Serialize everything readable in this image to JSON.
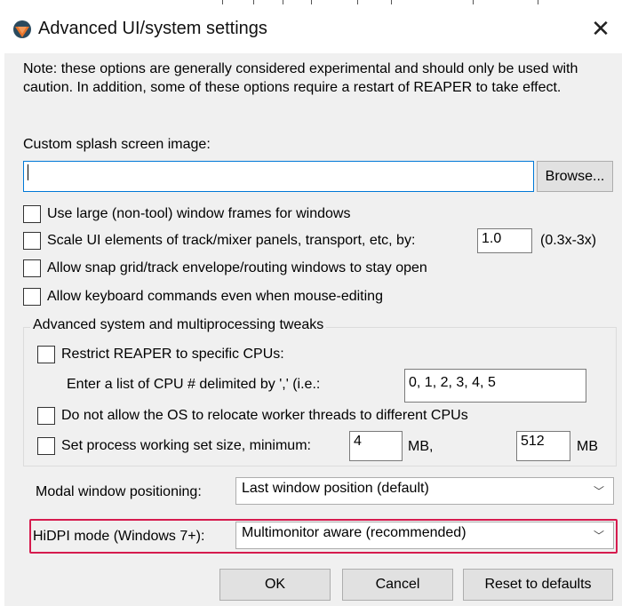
{
  "window": {
    "title": "Advanced UI/system settings",
    "app_icon": "reaper-logo-icon",
    "close_glyph": "✕"
  },
  "note": "Note: these options are generally considered experimental and should only be used with caution. In addition, some of these options require a restart of REAPER to take effect.",
  "splash": {
    "label": "Custom splash screen image:",
    "value": "",
    "browse_label": "Browse..."
  },
  "options": {
    "large_frames": {
      "label": "Use large (non-tool) window frames for windows",
      "checked": false
    },
    "scale_ui": {
      "label": "Scale UI elements of track/mixer panels, transport, etc, by:",
      "checked": false,
      "value": "1.0",
      "range": "(0.3x-3x)"
    },
    "snap_grid": {
      "label": "Allow snap grid/track envelope/routing windows to stay open",
      "checked": false
    },
    "keyboard": {
      "label": "Allow keyboard commands even when mouse-editing",
      "checked": false
    }
  },
  "advanced": {
    "title": "Advanced system and multiprocessing tweaks",
    "restrict_cpus": {
      "label": "Restrict REAPER to specific CPUs:",
      "checked": false
    },
    "cpu_list_label": "Enter a list of CPU # delimited by ',' (i.e.:",
    "cpu_list_value": "0, 1, 2, 3, 4, 5",
    "no_relocate": {
      "label": "Do not allow the OS to relocate worker threads to different CPUs",
      "checked": false
    },
    "working_set": {
      "label": "Set process working set size, minimum:",
      "checked": false,
      "min": "4",
      "min_unit": "MB,",
      "max": "512",
      "max_unit": "MB"
    }
  },
  "modal": {
    "label": "Modal window positioning:",
    "selected": "Last window position (default)"
  },
  "hidpi": {
    "label": "HiDPI mode (Windows 7+):",
    "selected": "Multimonitor aware (recommended)",
    "highlight_color": "#d61b4e"
  },
  "buttons": {
    "ok": "OK",
    "cancel": "Cancel",
    "reset": "Reset to defaults"
  }
}
